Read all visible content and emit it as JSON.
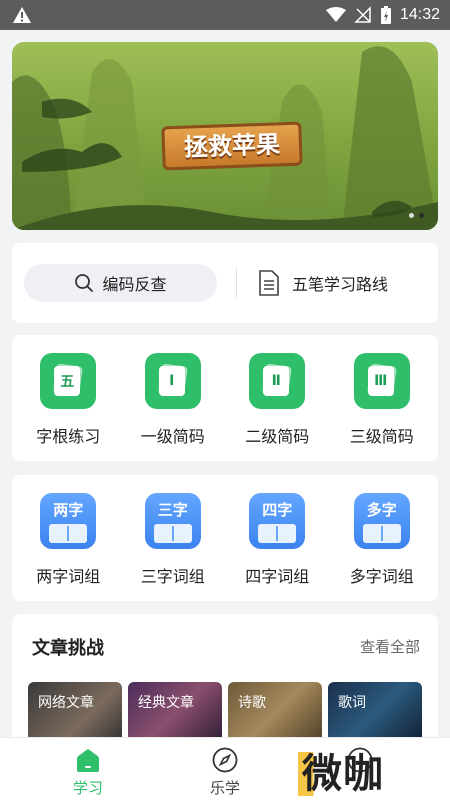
{
  "status_bar": {
    "time": "14:32"
  },
  "banner": {
    "title": "拯救苹果"
  },
  "search": {
    "lookup_label": "编码反查",
    "route_label": "五笔学习路线"
  },
  "grid1": [
    {
      "icon_text": "五",
      "label": "字根练习"
    },
    {
      "icon_text": "Ⅰ",
      "label": "一级简码"
    },
    {
      "icon_text": "Ⅱ",
      "label": "二级简码"
    },
    {
      "icon_text": "Ⅲ",
      "label": "三级简码"
    }
  ],
  "grid2": [
    {
      "icon_text": "两字",
      "label": "两字词组"
    },
    {
      "icon_text": "三字",
      "label": "三字词组"
    },
    {
      "icon_text": "四字",
      "label": "四字词组"
    },
    {
      "icon_text": "多字",
      "label": "多字词组"
    }
  ],
  "articles": {
    "title": "文章挑战",
    "more": "查看全部",
    "items": [
      {
        "label": "网络文章"
      },
      {
        "label": "经典文章"
      },
      {
        "label": "诗歌"
      },
      {
        "label": "歌词"
      }
    ]
  },
  "tabs": [
    {
      "label": "学习"
    },
    {
      "label": "乐学"
    }
  ],
  "watermark": "微咖",
  "colors": {
    "accent_green": "#2fbf6a",
    "accent_blue": "#3b82f0",
    "status_bar": "#5c5c5c"
  }
}
